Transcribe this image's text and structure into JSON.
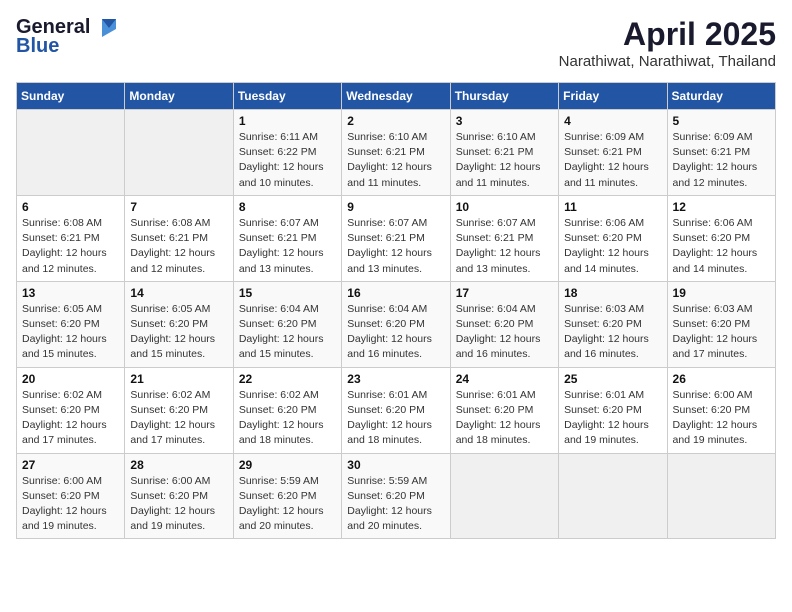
{
  "header": {
    "logo_general": "General",
    "logo_blue": "Blue",
    "month_year": "April 2025",
    "location": "Narathiwat, Narathiwat, Thailand"
  },
  "days_of_week": [
    "Sunday",
    "Monday",
    "Tuesday",
    "Wednesday",
    "Thursday",
    "Friday",
    "Saturday"
  ],
  "weeks": [
    [
      {
        "day": "",
        "info": ""
      },
      {
        "day": "",
        "info": ""
      },
      {
        "day": "1",
        "info": "Sunrise: 6:11 AM\nSunset: 6:22 PM\nDaylight: 12 hours\nand 10 minutes."
      },
      {
        "day": "2",
        "info": "Sunrise: 6:10 AM\nSunset: 6:21 PM\nDaylight: 12 hours\nand 11 minutes."
      },
      {
        "day": "3",
        "info": "Sunrise: 6:10 AM\nSunset: 6:21 PM\nDaylight: 12 hours\nand 11 minutes."
      },
      {
        "day": "4",
        "info": "Sunrise: 6:09 AM\nSunset: 6:21 PM\nDaylight: 12 hours\nand 11 minutes."
      },
      {
        "day": "5",
        "info": "Sunrise: 6:09 AM\nSunset: 6:21 PM\nDaylight: 12 hours\nand 12 minutes."
      }
    ],
    [
      {
        "day": "6",
        "info": "Sunrise: 6:08 AM\nSunset: 6:21 PM\nDaylight: 12 hours\nand 12 minutes."
      },
      {
        "day": "7",
        "info": "Sunrise: 6:08 AM\nSunset: 6:21 PM\nDaylight: 12 hours\nand 12 minutes."
      },
      {
        "day": "8",
        "info": "Sunrise: 6:07 AM\nSunset: 6:21 PM\nDaylight: 12 hours\nand 13 minutes."
      },
      {
        "day": "9",
        "info": "Sunrise: 6:07 AM\nSunset: 6:21 PM\nDaylight: 12 hours\nand 13 minutes."
      },
      {
        "day": "10",
        "info": "Sunrise: 6:07 AM\nSunset: 6:21 PM\nDaylight: 12 hours\nand 13 minutes."
      },
      {
        "day": "11",
        "info": "Sunrise: 6:06 AM\nSunset: 6:20 PM\nDaylight: 12 hours\nand 14 minutes."
      },
      {
        "day": "12",
        "info": "Sunrise: 6:06 AM\nSunset: 6:20 PM\nDaylight: 12 hours\nand 14 minutes."
      }
    ],
    [
      {
        "day": "13",
        "info": "Sunrise: 6:05 AM\nSunset: 6:20 PM\nDaylight: 12 hours\nand 15 minutes."
      },
      {
        "day": "14",
        "info": "Sunrise: 6:05 AM\nSunset: 6:20 PM\nDaylight: 12 hours\nand 15 minutes."
      },
      {
        "day": "15",
        "info": "Sunrise: 6:04 AM\nSunset: 6:20 PM\nDaylight: 12 hours\nand 15 minutes."
      },
      {
        "day": "16",
        "info": "Sunrise: 6:04 AM\nSunset: 6:20 PM\nDaylight: 12 hours\nand 16 minutes."
      },
      {
        "day": "17",
        "info": "Sunrise: 6:04 AM\nSunset: 6:20 PM\nDaylight: 12 hours\nand 16 minutes."
      },
      {
        "day": "18",
        "info": "Sunrise: 6:03 AM\nSunset: 6:20 PM\nDaylight: 12 hours\nand 16 minutes."
      },
      {
        "day": "19",
        "info": "Sunrise: 6:03 AM\nSunset: 6:20 PM\nDaylight: 12 hours\nand 17 minutes."
      }
    ],
    [
      {
        "day": "20",
        "info": "Sunrise: 6:02 AM\nSunset: 6:20 PM\nDaylight: 12 hours\nand 17 minutes."
      },
      {
        "day": "21",
        "info": "Sunrise: 6:02 AM\nSunset: 6:20 PM\nDaylight: 12 hours\nand 17 minutes."
      },
      {
        "day": "22",
        "info": "Sunrise: 6:02 AM\nSunset: 6:20 PM\nDaylight: 12 hours\nand 18 minutes."
      },
      {
        "day": "23",
        "info": "Sunrise: 6:01 AM\nSunset: 6:20 PM\nDaylight: 12 hours\nand 18 minutes."
      },
      {
        "day": "24",
        "info": "Sunrise: 6:01 AM\nSunset: 6:20 PM\nDaylight: 12 hours\nand 18 minutes."
      },
      {
        "day": "25",
        "info": "Sunrise: 6:01 AM\nSunset: 6:20 PM\nDaylight: 12 hours\nand 19 minutes."
      },
      {
        "day": "26",
        "info": "Sunrise: 6:00 AM\nSunset: 6:20 PM\nDaylight: 12 hours\nand 19 minutes."
      }
    ],
    [
      {
        "day": "27",
        "info": "Sunrise: 6:00 AM\nSunset: 6:20 PM\nDaylight: 12 hours\nand 19 minutes."
      },
      {
        "day": "28",
        "info": "Sunrise: 6:00 AM\nSunset: 6:20 PM\nDaylight: 12 hours\nand 19 minutes."
      },
      {
        "day": "29",
        "info": "Sunrise: 5:59 AM\nSunset: 6:20 PM\nDaylight: 12 hours\nand 20 minutes."
      },
      {
        "day": "30",
        "info": "Sunrise: 5:59 AM\nSunset: 6:20 PM\nDaylight: 12 hours\nand 20 minutes."
      },
      {
        "day": "",
        "info": ""
      },
      {
        "day": "",
        "info": ""
      },
      {
        "day": "",
        "info": ""
      }
    ]
  ]
}
